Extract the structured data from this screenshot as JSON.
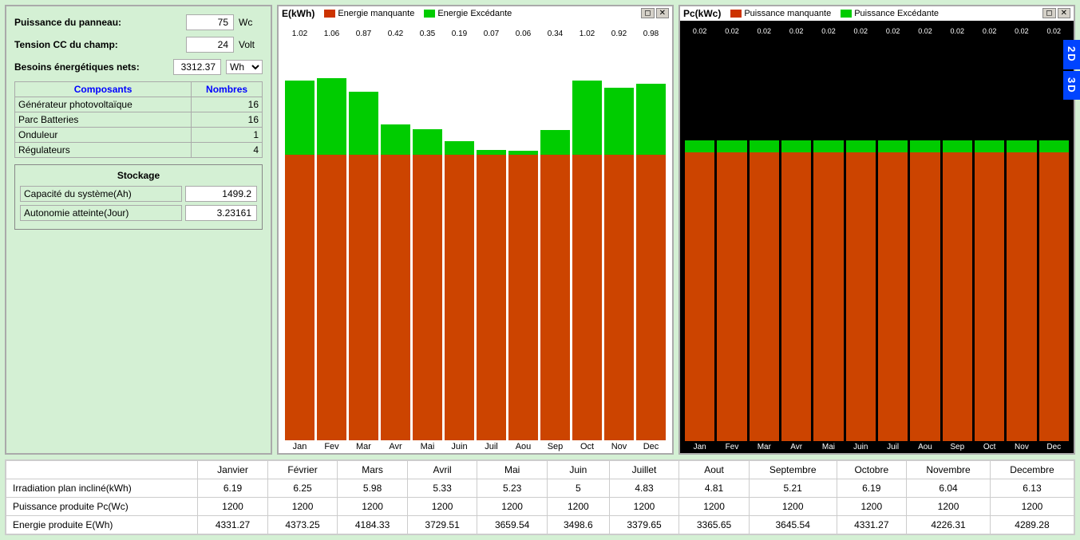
{
  "leftPanel": {
    "puissanceLabel": "Puissance du panneau:",
    "puissanceValue": "75",
    "puissanceUnit": "Wc",
    "tensionLabel": "Tension CC du champ:",
    "tensionValue": "24",
    "tensionUnit": "Volt",
    "besoinsLabel": "Besoins énergétiques nets:",
    "besoinsValue": "3312.37",
    "besoinsUnit": "Wh",
    "table": {
      "col1": "Composants",
      "col2": "Nombres",
      "rows": [
        {
          "name": "Générateur photovoltaïque",
          "value": "16"
        },
        {
          "name": "Parc Batteries",
          "value": "16"
        },
        {
          "name": "Onduleur",
          "value": "1"
        },
        {
          "name": "Régulateurs",
          "value": "4"
        }
      ]
    },
    "stockage": {
      "title": "Stockage",
      "rows": [
        {
          "label": "Capacité du système(Ah)",
          "value": "1499.2"
        },
        {
          "label": "Autonomie atteinte(Jour)",
          "value": "3.23161"
        }
      ]
    }
  },
  "chartE": {
    "title": "E(kWh)",
    "legend": [
      {
        "label": "Energie manquante",
        "color": "#cc3300"
      },
      {
        "label": "Energie Excédante",
        "color": "#00cc00"
      }
    ],
    "months": [
      "Jan",
      "Fev",
      "Mar",
      "Avr",
      "Mai",
      "Juin",
      "Juil",
      "Aou",
      "Sep",
      "Oct",
      "Nov",
      "Dec"
    ],
    "greenValues": [
      1.02,
      1.06,
      0.87,
      0.42,
      0.35,
      0.19,
      0.07,
      0.06,
      0.34,
      1.02,
      0.92,
      0.98
    ],
    "totalHeight": 380
  },
  "chartPc": {
    "title": "Pc(kWc)",
    "legend": [
      {
        "label": "Puissance manquante",
        "color": "#cc3300"
      },
      {
        "label": "Puissance Excédante",
        "color": "#00cc00"
      }
    ],
    "months": [
      "Jan",
      "Fev",
      "Mar",
      "Avr",
      "Mai",
      "Juin",
      "Juil",
      "Aou",
      "Sep",
      "Oct",
      "Nov",
      "Dec"
    ],
    "greenValues": [
      0.02,
      0.02,
      0.02,
      0.02,
      0.02,
      0.02,
      0.02,
      0.02,
      0.02,
      0.02,
      0.02,
      0.02
    ]
  },
  "bottomTable": {
    "columns": [
      "",
      "Janvier",
      "Février",
      "Mars",
      "Avril",
      "Mai",
      "Juin",
      "Juillet",
      "Aout",
      "Septembre",
      "Octobre",
      "Novembre",
      "Decembre"
    ],
    "rows": [
      {
        "label": "Irradiation plan incliné(kWh)",
        "values": [
          "6.19",
          "6.25",
          "5.98",
          "5.33",
          "5.23",
          "5",
          "4.83",
          "4.81",
          "5.21",
          "6.19",
          "6.04",
          "6.13"
        ]
      },
      {
        "label": "Puissance produite Pc(Wc)",
        "values": [
          "1200",
          "1200",
          "1200",
          "1200",
          "1200",
          "1200",
          "1200",
          "1200",
          "1200",
          "1200",
          "1200",
          "1200"
        ]
      },
      {
        "label": "Energie produite E(Wh)",
        "values": [
          "4331.27",
          "4373.25",
          "4184.33",
          "3729.51",
          "3659.54",
          "3498.6",
          "3379.65",
          "3365.65",
          "3645.54",
          "4331.27",
          "4226.31",
          "4289.28"
        ]
      }
    ]
  },
  "sideButtons": {
    "btn2d": "2D",
    "btn3d": "3D"
  }
}
